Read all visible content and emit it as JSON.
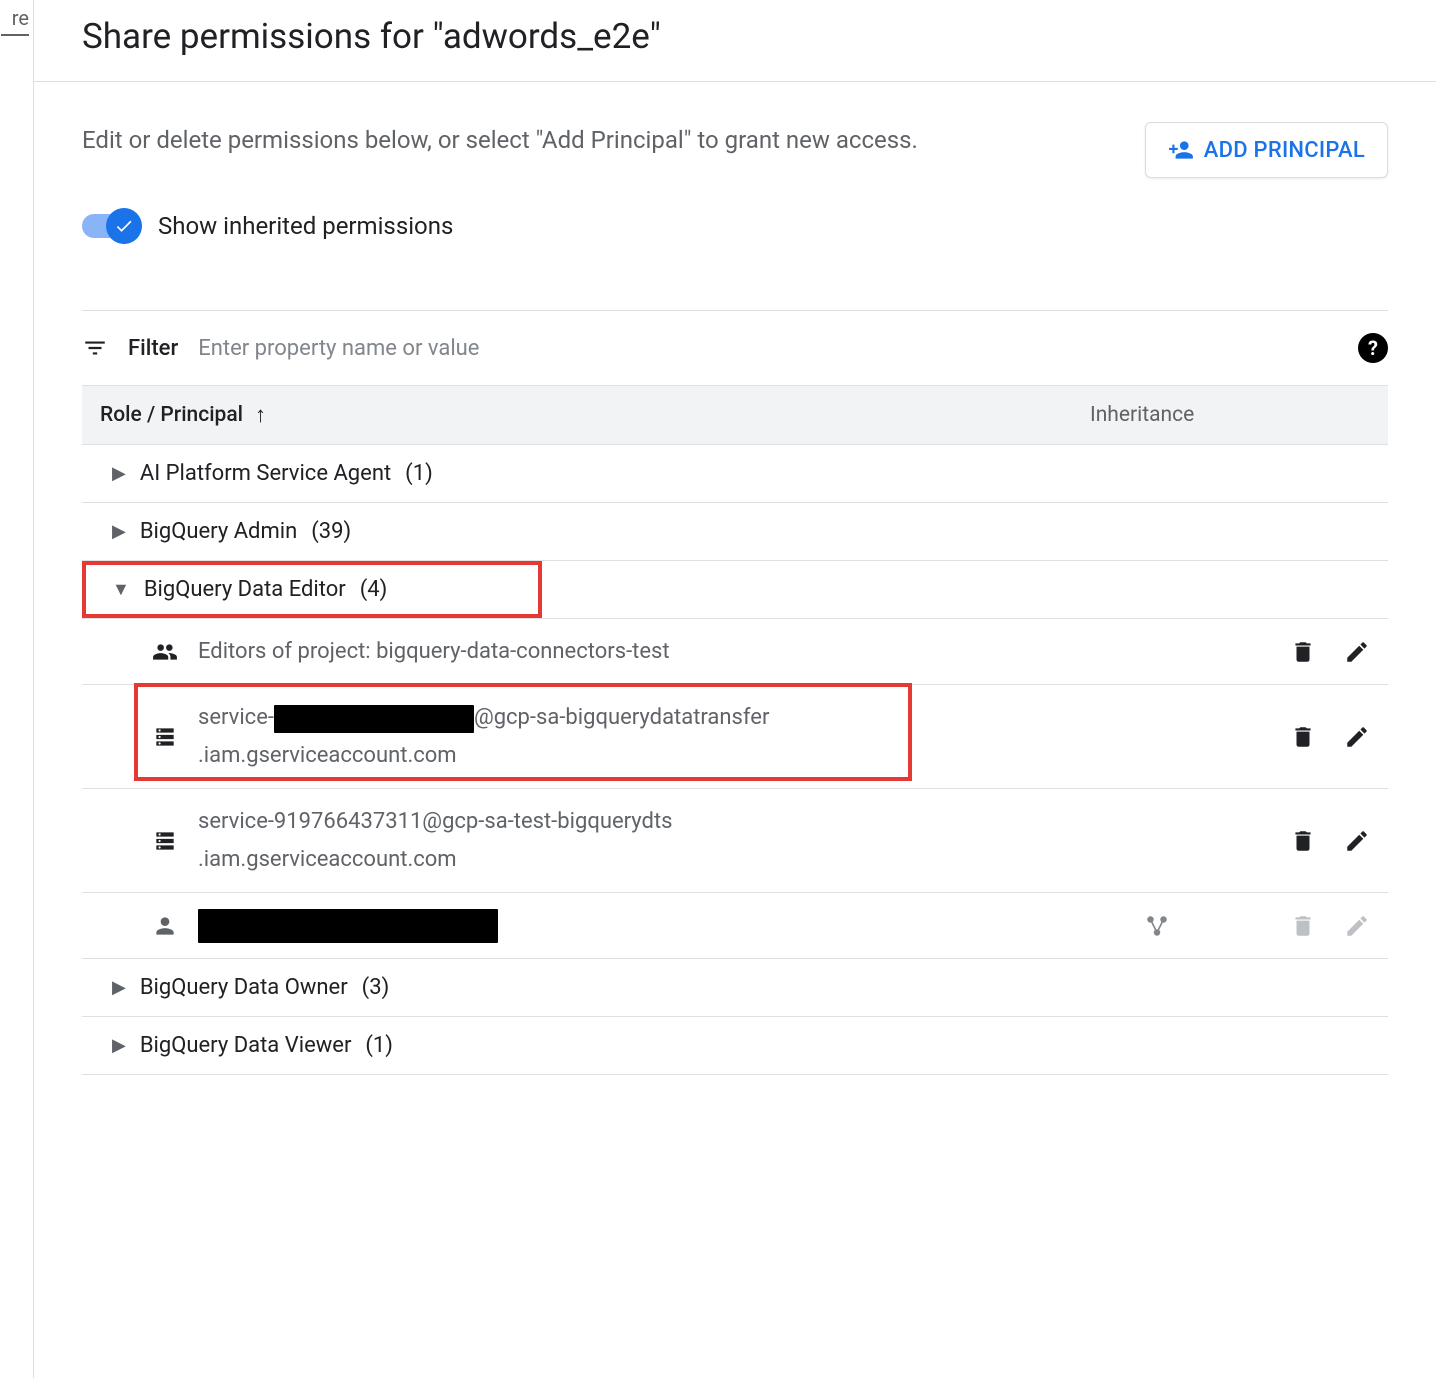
{
  "left_rail_text": "re",
  "title": "Share permissions for \"adwords_e2e\"",
  "description": "Edit or delete permissions below, or select \"Add Principal\" to grant new access.",
  "add_principal_label": "ADD PRINCIPAL",
  "toggle_label": "Show inherited permissions",
  "filter": {
    "label": "Filter",
    "placeholder": "Enter property name or value"
  },
  "columns": {
    "role": "Role / Principal",
    "inheritance": "Inheritance"
  },
  "roles": [
    {
      "name": "AI Platform Service Agent",
      "count": "(1)",
      "expanded": false
    },
    {
      "name": "BigQuery Admin",
      "count": "(39)",
      "expanded": false
    },
    {
      "name": "BigQuery Data Editor",
      "count": "(4)",
      "expanded": true,
      "highlight": true
    },
    {
      "name": "BigQuery Data Owner",
      "count": "(3)",
      "expanded": false
    },
    {
      "name": "BigQuery Data Viewer",
      "count": "(1)",
      "expanded": false
    }
  ],
  "data_editor_principals": [
    {
      "icon": "group",
      "line1": "Editors of project: bigquery-data-connectors-test",
      "line2": "",
      "actions": [
        "delete",
        "edit"
      ],
      "highlight": false,
      "redacted": false
    },
    {
      "icon": "service-account",
      "line1_prefix": "service-",
      "line1_suffix": "@gcp-sa-bigquerydatatransfer",
      "line2": ".iam.gserviceaccount.com",
      "actions": [
        "delete",
        "edit"
      ],
      "highlight": true,
      "redacted_segment": true
    },
    {
      "icon": "service-account",
      "line1": "service-919766437311@gcp-sa-test-bigquerydts",
      "line2": ".iam.gserviceaccount.com",
      "actions": [
        "delete",
        "edit"
      ]
    },
    {
      "icon": "person",
      "redacted_full": true,
      "inherited": true,
      "actions": [
        "delete",
        "edit"
      ],
      "actions_disabled": true
    }
  ]
}
